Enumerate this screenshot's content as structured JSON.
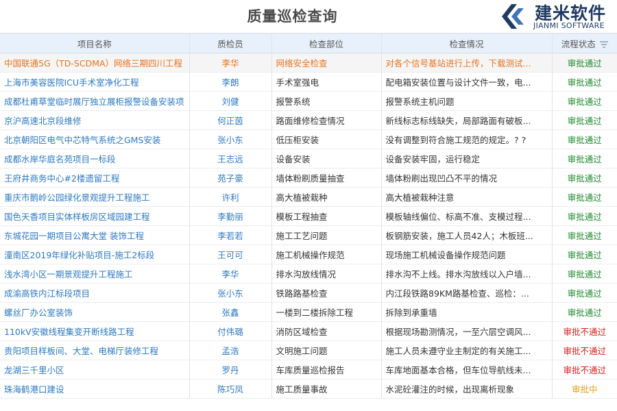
{
  "header": {
    "title": "质量巡检查询",
    "logo_cn": "建米软件",
    "logo_en": "JIANMI SOFTWARE"
  },
  "table": {
    "columns": [
      "项目名称",
      "质检员",
      "检查部位",
      "检查情况",
      "流程状态"
    ],
    "rows": [
      {
        "project": "中国联通5G（TD-SCDMA）网络三期四川工程",
        "inspector": "李华",
        "part": "网络安全检查",
        "situation": "对各个信号基站进行上传，下载测试...",
        "status": "审批通过",
        "status_type": "pass"
      },
      {
        "project": "上海市美容医院ICU手术室净化工程",
        "inspector": "李朗",
        "part": "手术室强电",
        "situation": "配电箱安装位置与设计文件一致，电...",
        "status": "审批通过",
        "status_type": "pass"
      },
      {
        "project": "成都杜甫草堂临时展厅独立展柜报警设备安装项",
        "inspector": "刘健",
        "part": "报警系统",
        "situation": "报警系统主机问题",
        "status": "审批通过",
        "status_type": "pass"
      },
      {
        "project": "京沪高速北京段维修",
        "inspector": "何正茵",
        "part": "路面维修检查情况",
        "situation": "新线标志标线缺失，局部路面有破板...",
        "status": "审批通过",
        "status_type": "pass"
      },
      {
        "project": "北京朝阳区电气中芯特气系统之GMS安装",
        "inspector": "张小东",
        "part": "低压柜安装",
        "situation": "没有调整到符合施工规范的规定。? ?",
        "status": "审批通过",
        "status_type": "pass"
      },
      {
        "project": "成都水岸华庭名苑项目一标段",
        "inspector": "王志远",
        "part": "设备安装",
        "situation": "设备安装牢固，运行稳定",
        "status": "审批通过",
        "status_type": "pass"
      },
      {
        "project": "王府井商务中心#2楼遗留工程",
        "inspector": "苑子豪",
        "part": "墙体粉刷质量抽查",
        "situation": "墙体粉刷出现凹凸不平的情况",
        "status": "审批通过",
        "status_type": "pass"
      },
      {
        "project": "重庆市鹅岭公园绿化景观提升工程施工",
        "inspector": "许利",
        "part": "高大植被栽种",
        "situation": "高大植被栽种注意",
        "status": "审批通过",
        "status_type": "pass"
      },
      {
        "project": "国色天香项目实体样板房区域园建工程",
        "inspector": "李勤丽",
        "part": "模板工程抽查",
        "situation": "模板轴线偏位、标高不准、支模过程...",
        "status": "审批通过",
        "status_type": "pass"
      },
      {
        "project": "东城花园一期项目公寓大堂 装饰工程",
        "inspector": "李若若",
        "part": "施工工艺问题",
        "situation": "板钢筋安装，施工人员42人；木板班...",
        "status": "审批通过",
        "status_type": "pass"
      },
      {
        "project": "潼南区2019年绿化补贴项目-施工2标段",
        "inspector": "王可可",
        "part": "施工机械操作规范",
        "situation": "现场施工机械设备操作规范问题",
        "status": "审批通过",
        "status_type": "pass"
      },
      {
        "project": "浅水湾小区一期景观提升工程施工",
        "inspector": "李华",
        "part": "排水沟放线情况",
        "situation": "排水沟不上线。排水沟放线以入户墙...",
        "status": "审批通过",
        "status_type": "pass"
      },
      {
        "project": "成渝高铁内江标段项目",
        "inspector": "张小东",
        "part": "铁路路基检查",
        "situation": "内江段铁路89KM路基检查、巡检：...",
        "status": "审批通过",
        "status_type": "pass"
      },
      {
        "project": "螺丝厂办公室装饰",
        "inspector": "张鑫",
        "part": "一楼到二楼拆除工程",
        "situation": "拆除到承重墙",
        "status": "审批通过",
        "status_type": "pass"
      },
      {
        "project": "110kV安徽线程集变开断线路工程",
        "inspector": "付伟璐",
        "part": "消防区域检查",
        "situation": "根据现场勘测情况，一至六层空调风...",
        "status": "审批不通过",
        "status_type": "fail"
      },
      {
        "project": "贵阳项目样板间、大堂、电梯厅装修工程",
        "inspector": "孟浩",
        "part": "文明施工问题",
        "situation": "施工人员未遵守业主制定的有关施工...",
        "status": "审批不通过",
        "status_type": "fail"
      },
      {
        "project": "龙湖三千里小区",
        "inspector": "罗丹",
        "part": "车库质量巡检报告",
        "situation": "车库地面基本合格，但车位导航线未...",
        "status": "审批不通过",
        "status_type": "fail"
      },
      {
        "project": "珠海鹤港口建设",
        "inspector": "陈巧凤",
        "part": "施工质量事故",
        "situation": "水泥砼灌注的时候，出现离析现象",
        "status": "审批中",
        "status_type": "pending"
      }
    ]
  }
}
